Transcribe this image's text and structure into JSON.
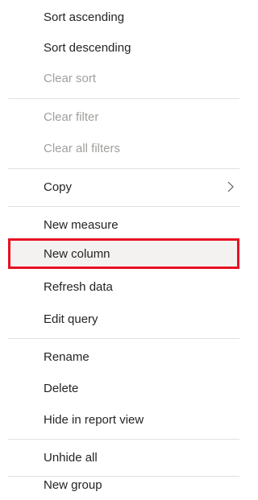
{
  "context_menu": {
    "items": [
      {
        "label": "Sort ascending",
        "enabled": true
      },
      {
        "label": "Sort descending",
        "enabled": true
      },
      {
        "label": "Clear sort",
        "enabled": false
      },
      {
        "label": "Clear filter",
        "enabled": false
      },
      {
        "label": "Clear all filters",
        "enabled": false
      },
      {
        "label": "Copy",
        "enabled": true,
        "submenu": true,
        "submenu_icon": "chevron-right-icon"
      },
      {
        "label": "New measure",
        "enabled": true
      },
      {
        "label": "New column",
        "enabled": true,
        "highlighted": true
      },
      {
        "label": "Refresh data",
        "enabled": true
      },
      {
        "label": "Edit query",
        "enabled": true
      },
      {
        "label": "Rename",
        "enabled": true
      },
      {
        "label": "Delete",
        "enabled": true
      },
      {
        "label": "Hide in report view",
        "enabled": true
      },
      {
        "label": "Unhide all",
        "enabled": true
      },
      {
        "label": "New group",
        "enabled": true
      }
    ]
  },
  "colors": {
    "text": "#252423",
    "disabled_text": "#a19f9d",
    "separator": "#e1dfdd",
    "highlight_border": "#e81123",
    "highlight_background": "#f3f2f1"
  }
}
